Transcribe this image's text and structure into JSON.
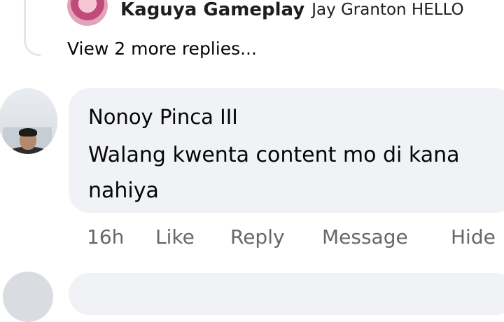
{
  "reply_preview": {
    "author": "Kaguya Gameplay",
    "text": "Jay Granton HELLO"
  },
  "view_more": "View 2 more replies...",
  "comment": {
    "author": "Nonoy Pinca III",
    "text": "Walang kwenta content mo di kana nahiya",
    "time": "16h",
    "actions": {
      "like": "Like",
      "reply": "Reply",
      "message": "Message",
      "hide": "Hide"
    }
  }
}
